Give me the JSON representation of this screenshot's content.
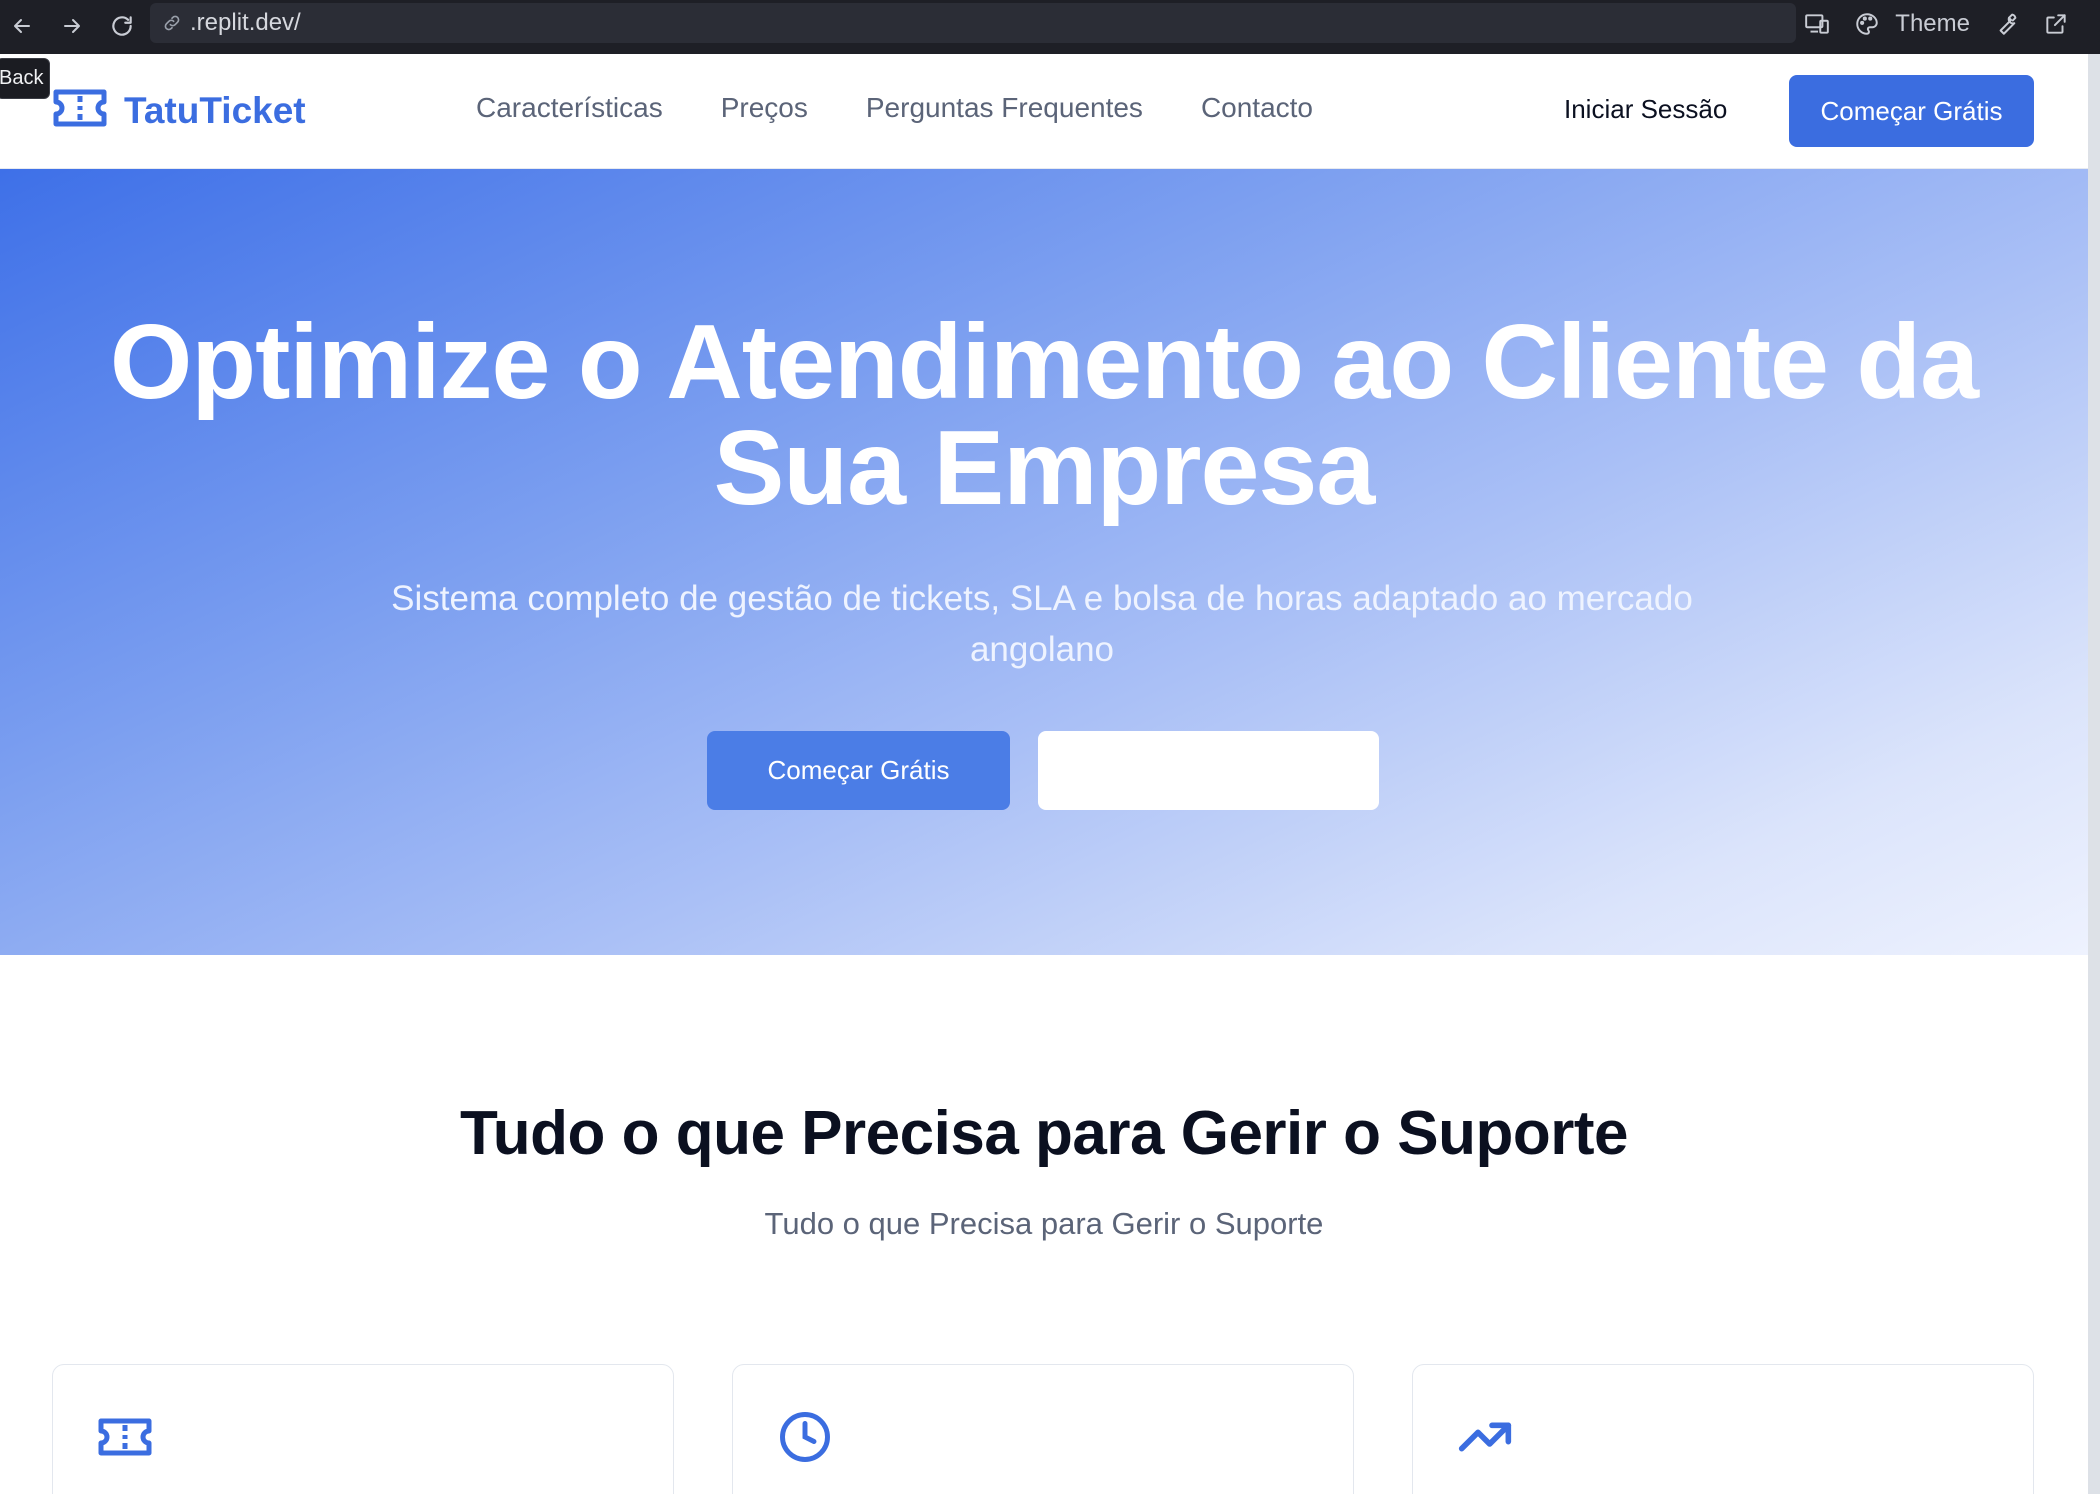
{
  "browser": {
    "url": ".replit.dev/",
    "theme_label": "Theme"
  },
  "tooltip": {
    "text": "Back"
  },
  "header": {
    "brand": "TatuTicket",
    "nav": [
      {
        "label": "Características"
      },
      {
        "label": "Preços"
      },
      {
        "label": "Perguntas Frequentes"
      },
      {
        "label": "Contacto"
      }
    ],
    "login_label": "Iniciar Sessão",
    "cta_label": "Começar Grátis"
  },
  "hero": {
    "title_line1": "Optimize o Atendimento ao Cliente da",
    "title_line2": "Sua Empresa",
    "subtitle": "Sistema completo de gestão de tickets, SLA e bolsa de horas adaptado ao mercado angolano",
    "primary_label": "Começar Grátis",
    "secondary_label": ""
  },
  "features": {
    "title": "Tudo o que Precisa para Gerir o Suporte",
    "subtitle": "Tudo o que Precisa para Gerir o Suporte",
    "cards": [
      {
        "icon": "ticket-icon"
      },
      {
        "icon": "clock-icon"
      },
      {
        "icon": "trending-up-icon"
      }
    ]
  },
  "colors": {
    "brand": "#3b6de0",
    "browser_bar": "#1e1f26"
  }
}
